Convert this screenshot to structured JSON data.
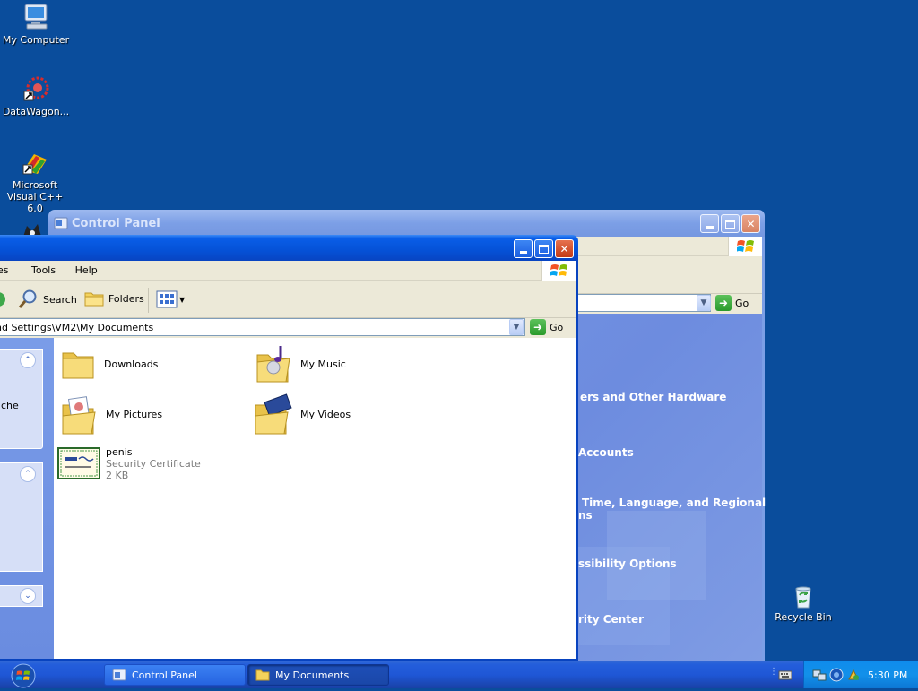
{
  "desktop_icons": [
    {
      "id": "my-computer",
      "label": "My Computer"
    },
    {
      "id": "datawagon",
      "label": "DataWagon..."
    },
    {
      "id": "visual-cpp",
      "label": "Microsoft Visual C++ 6.0"
    },
    {
      "id": "recycle-bin",
      "label": "Recycle Bin"
    }
  ],
  "control_panel": {
    "title": "Control Panel",
    "go_label": "Go",
    "categories": [
      "ers and Other Hardware",
      "Accounts",
      "Time, Language, and Regional",
      "ns",
      "ssibility Options",
      "rity Center"
    ]
  },
  "my_documents": {
    "menu": [
      "es",
      "Tools",
      "Help"
    ],
    "toolbar": {
      "search_label": "Search",
      "folders_label": "Folders"
    },
    "address": "nd Settings\\VM2\\My Documents",
    "go_label": "Go",
    "left_pane_text": "che",
    "items": [
      {
        "name": "Downloads",
        "type": "folder"
      },
      {
        "name": "My Music",
        "type": "music-folder"
      },
      {
        "name": "My Pictures",
        "type": "pictures-folder"
      },
      {
        "name": "My Videos",
        "type": "videos-folder"
      },
      {
        "name": "penis",
        "type": "certificate",
        "subtitle": "Security Certificate",
        "size": "2 KB"
      }
    ]
  },
  "taskbar": {
    "buttons": [
      {
        "label": "Control Panel",
        "active": false
      },
      {
        "label": "My Documents",
        "active": true
      }
    ],
    "clock": "5:30 PM"
  },
  "colors": {
    "desktop": "#0a4d9c",
    "taskbar": "#245edb",
    "title_active": "#0551d6",
    "title_inactive": "#7c9fe6"
  }
}
